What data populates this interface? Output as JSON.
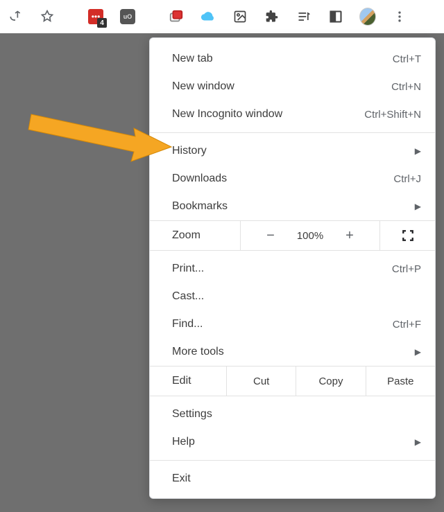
{
  "toolbar": {
    "badge_count": "4"
  },
  "menu": {
    "new_tab": {
      "label": "New tab",
      "shortcut": "Ctrl+T"
    },
    "new_window": {
      "label": "New window",
      "shortcut": "Ctrl+N"
    },
    "incognito": {
      "label": "New Incognito window",
      "shortcut": "Ctrl+Shift+N"
    },
    "history": {
      "label": "History"
    },
    "downloads": {
      "label": "Downloads",
      "shortcut": "Ctrl+J"
    },
    "bookmarks": {
      "label": "Bookmarks"
    },
    "zoom": {
      "label": "Zoom",
      "minus": "−",
      "pct": "100%",
      "plus": "+"
    },
    "print": {
      "label": "Print...",
      "shortcut": "Ctrl+P"
    },
    "cast": {
      "label": "Cast..."
    },
    "find": {
      "label": "Find...",
      "shortcut": "Ctrl+F"
    },
    "more_tools": {
      "label": "More tools"
    },
    "edit": {
      "label": "Edit",
      "cut": "Cut",
      "copy": "Copy",
      "paste": "Paste"
    },
    "settings": {
      "label": "Settings"
    },
    "help": {
      "label": "Help"
    },
    "exit": {
      "label": "Exit"
    }
  }
}
